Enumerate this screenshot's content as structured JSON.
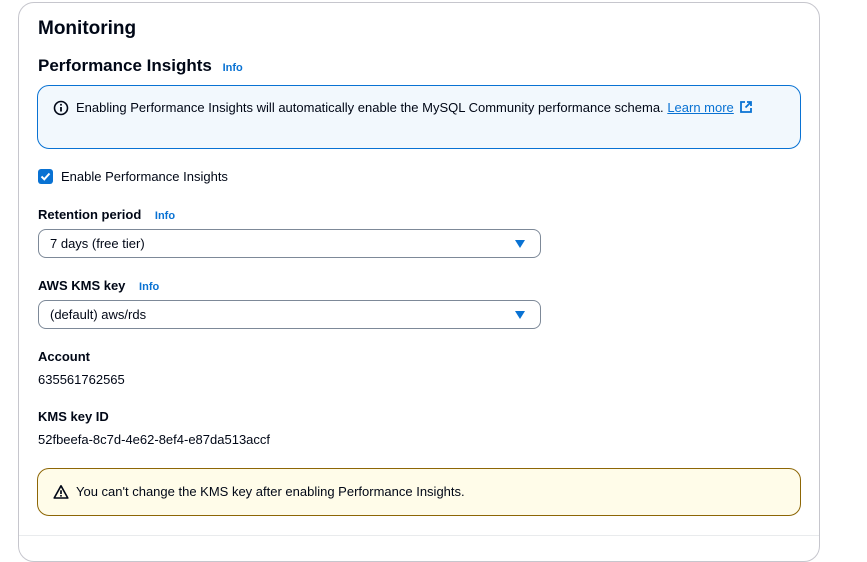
{
  "section": {
    "title": "Monitoring"
  },
  "performance_insights": {
    "title": "Performance Insights",
    "info_label": "Info",
    "alert": {
      "text": "Enabling Performance Insights will automatically enable the MySQL Community performance schema.",
      "link_label": "Learn more"
    },
    "enable_checkbox": {
      "label": "Enable Performance Insights",
      "checked": true
    },
    "retention_period": {
      "label": "Retention period",
      "info_label": "Info",
      "selected": "7 days (free tier)"
    },
    "kms_key": {
      "label": "AWS KMS key",
      "info_label": "Info",
      "selected": "(default) aws/rds"
    },
    "account": {
      "label": "Account",
      "value": "635561762565"
    },
    "kms_key_id": {
      "label": "KMS key ID",
      "value": "52fbeefa-8c7d-4e62-8ef4-e87da513accf"
    },
    "warning": {
      "text": "You can't change the KMS key after enabling Performance Insights."
    }
  },
  "icons": {
    "info": "info-circle-icon",
    "external": "external-link-icon",
    "check": "check-icon",
    "caret": "caret-down-icon",
    "warning": "warning-triangle-icon"
  },
  "colors": {
    "accent": "#0972d3",
    "info_bg": "#f2f8fd",
    "warning_border": "#8d6605",
    "warning_bg": "#fffce9"
  }
}
